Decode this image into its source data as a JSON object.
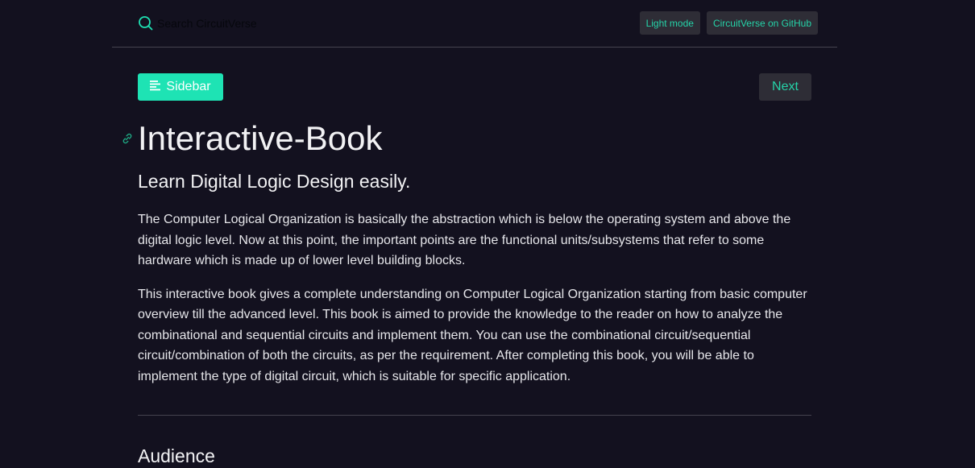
{
  "header": {
    "search": {
      "placeholder": "Search CircuitVerse",
      "icon": "search-icon"
    },
    "light_mode_label": "Light mode",
    "github_label": "CircuitVerse on GitHub"
  },
  "nav": {
    "sidebar_label": "Sidebar",
    "sidebar_icon": "menu-lines-icon",
    "next_label": "Next"
  },
  "main": {
    "title": "Interactive-Book",
    "subtitle": "Learn Digital Logic Design easily.",
    "paragraphs": [
      "The Computer Logical Organization is basically the abstraction which is below the operating system and above the digital logic level. Now at this point, the important points are the functional units/subsystems that refer to some hardware which is made up of lower level building blocks.",
      "This interactive book gives a complete understanding on Computer Logical Organization starting from basic computer overview till the advanced level. This book is aimed to provide the knowledge to the reader on how to analyze the combinational and sequential circuits and implement them. You can use the combinational circuit/sequential circuit/combination of both the circuits, as per the requirement. After completing this book, you will be able to implement the type of digital circuit, which is suitable for specific application."
    ],
    "section_heading": "Audience"
  },
  "colors": {
    "background": "#13111f",
    "accent": "#1ee3b4",
    "accent_text": "#25d3a8",
    "button_bg": "#2e2d36",
    "text": "#e6e6ea",
    "divider": "#45434f"
  }
}
